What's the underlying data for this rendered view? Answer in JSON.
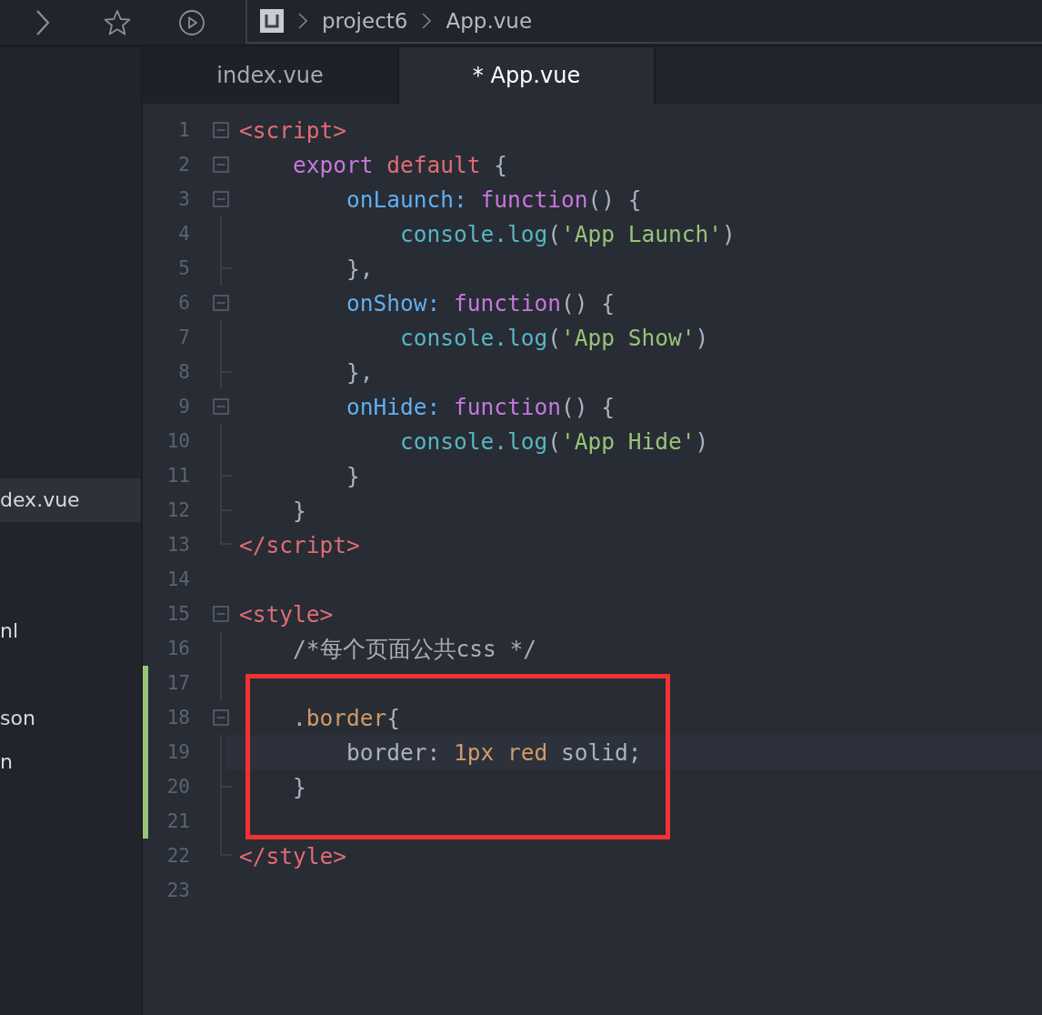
{
  "breadcrumb": [
    "project6",
    "App.vue"
  ],
  "sidebar": {
    "items": [
      {
        "label": "dex.vue",
        "selected": true
      },
      {
        "label": "nl",
        "selected": false
      },
      {
        "label": "son",
        "selected": false
      },
      {
        "label": "n",
        "selected": false
      }
    ]
  },
  "tabs": [
    {
      "label": "index.vue",
      "selected": false
    },
    {
      "label": "* App.vue",
      "selected": true
    }
  ],
  "editor": {
    "lines": [
      {
        "number": "1",
        "kind": "box",
        "tokens": [
          {
            "kind": "tag",
            "text": "<script>"
          }
        ]
      },
      {
        "number": "2",
        "kind": "box",
        "tokens": [
          {
            "kind": "keyword",
            "text": "    export "
          },
          {
            "kind": "tag",
            "text": "default"
          },
          {
            "kind": "plain",
            "text": " {"
          }
        ]
      },
      {
        "number": "3",
        "kind": "box",
        "tokens": [
          {
            "kind": "prop",
            "text": "        onLaunch: "
          },
          {
            "kind": "keyword",
            "text": "function"
          },
          {
            "kind": "plain",
            "text": "() {"
          }
        ]
      },
      {
        "number": "4",
        "kind": "line",
        "tokens": [
          {
            "kind": "object",
            "text": "            console.log"
          },
          {
            "kind": "plain",
            "text": "("
          },
          {
            "kind": "string",
            "text": "'App Launch'"
          },
          {
            "kind": "plain",
            "text": ")"
          }
        ]
      },
      {
        "number": "5",
        "kind": "tick",
        "tokens": [
          {
            "kind": "plain",
            "text": "        },"
          }
        ]
      },
      {
        "number": "6",
        "kind": "box",
        "tokens": [
          {
            "kind": "prop",
            "text": "        onShow: "
          },
          {
            "kind": "keyword",
            "text": "function"
          },
          {
            "kind": "plain",
            "text": "() {"
          }
        ]
      },
      {
        "number": "7",
        "kind": "line",
        "tokens": [
          {
            "kind": "object",
            "text": "            console.log"
          },
          {
            "kind": "plain",
            "text": "("
          },
          {
            "kind": "string",
            "text": "'App Show'"
          },
          {
            "kind": "plain",
            "text": ")"
          }
        ]
      },
      {
        "number": "8",
        "kind": "tick",
        "tokens": [
          {
            "kind": "plain",
            "text": "        },"
          }
        ]
      },
      {
        "number": "9",
        "kind": "box",
        "tokens": [
          {
            "kind": "prop",
            "text": "        onHide: "
          },
          {
            "kind": "keyword",
            "text": "function"
          },
          {
            "kind": "plain",
            "text": "() {"
          }
        ]
      },
      {
        "number": "10",
        "kind": "line",
        "tokens": [
          {
            "kind": "object",
            "text": "            console.log"
          },
          {
            "kind": "plain",
            "text": "("
          },
          {
            "kind": "string",
            "text": "'App Hide'"
          },
          {
            "kind": "plain",
            "text": ")"
          }
        ]
      },
      {
        "number": "11",
        "kind": "tick",
        "tokens": [
          {
            "kind": "plain",
            "text": "        }"
          }
        ]
      },
      {
        "number": "12",
        "kind": "tick",
        "tokens": [
          {
            "kind": "plain",
            "text": "    }"
          }
        ]
      },
      {
        "number": "13",
        "kind": "end",
        "tokens": [
          {
            "kind": "tag",
            "text": "</script>"
          }
        ]
      },
      {
        "number": "14",
        "kind": "none"
      },
      {
        "number": "15",
        "kind": "box",
        "tokens": [
          {
            "kind": "tag",
            "text": "<style>"
          }
        ]
      },
      {
        "number": "16",
        "kind": "line",
        "tokens": [
          {
            "kind": "comment",
            "text": "    /*每个页面公共css */"
          }
        ]
      },
      {
        "number": "17",
        "kind": "line",
        "modified": true,
        "boxed": true
      },
      {
        "number": "18",
        "kind": "box",
        "modified": true,
        "boxed": true,
        "tokens": [
          {
            "kind": "plain",
            "text": "    ."
          },
          {
            "kind": "number",
            "text": "border"
          },
          {
            "kind": "plain",
            "text": "{"
          }
        ]
      },
      {
        "number": "19",
        "kind": "line",
        "modified": true,
        "boxed": true,
        "current": true,
        "tokens": [
          {
            "kind": "plain",
            "text": "        border: "
          },
          {
            "kind": "number",
            "text": "1px red"
          },
          {
            "kind": "plain",
            "text": " solid;"
          }
        ]
      },
      {
        "number": "20",
        "kind": "tick",
        "modified": true,
        "boxed": true,
        "tokens": [
          {
            "kind": "plain",
            "text": "    }"
          }
        ]
      },
      {
        "number": "21",
        "kind": "line",
        "modified": true,
        "boxed": true
      },
      {
        "number": "22",
        "kind": "end",
        "tokens": [
          {
            "kind": "tag",
            "text": "</style>"
          }
        ]
      },
      {
        "number": "23",
        "kind": "none"
      }
    ]
  }
}
